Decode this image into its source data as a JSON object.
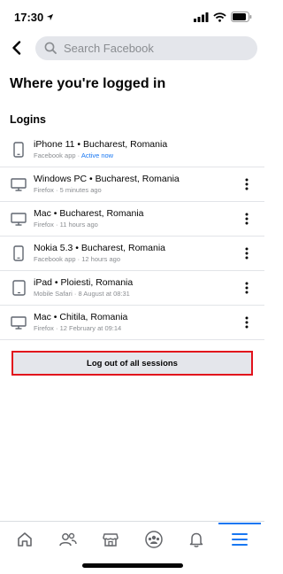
{
  "status": {
    "time": "17:30"
  },
  "search": {
    "placeholder": "Search Facebook"
  },
  "page": {
    "title": "Where you're logged in",
    "section": "Logins"
  },
  "sessions": [
    {
      "device": "iPhone 11",
      "location": "Bucharest, Romania",
      "app": "Facebook app",
      "when": "Active now",
      "icon": "phone-icon",
      "has_menu": false
    },
    {
      "device": "Windows PC",
      "location": "Bucharest, Romania",
      "app": "Firefox",
      "when": "5 minutes ago",
      "icon": "desktop-icon",
      "has_menu": true
    },
    {
      "device": "Mac",
      "location": "Bucharest, Romania",
      "app": "Firefox",
      "when": "11 hours ago",
      "icon": "desktop-icon",
      "has_menu": true
    },
    {
      "device": "Nokia 5.3",
      "location": "Bucharest, Romania",
      "app": "Facebook app",
      "when": "12 hours ago",
      "icon": "phone-icon",
      "has_menu": true
    },
    {
      "device": "iPad",
      "location": "Ploiesti, Romania",
      "app": "Mobile Safari",
      "when": "8 August at 08:31",
      "icon": "tablet-icon",
      "has_menu": true
    },
    {
      "device": "Mac",
      "location": "Chitila, Romania",
      "app": "Firefox",
      "when": "12 February at 09:14",
      "icon": "desktop-icon",
      "has_menu": true
    }
  ],
  "logout_label": "Log out of all sessions",
  "nav": [
    "home-icon",
    "friends-icon",
    "marketplace-icon",
    "groups-icon",
    "notifications-icon",
    "menu-icon"
  ],
  "colors": {
    "accent": "#1877f2",
    "highlight": "#e2121c"
  }
}
